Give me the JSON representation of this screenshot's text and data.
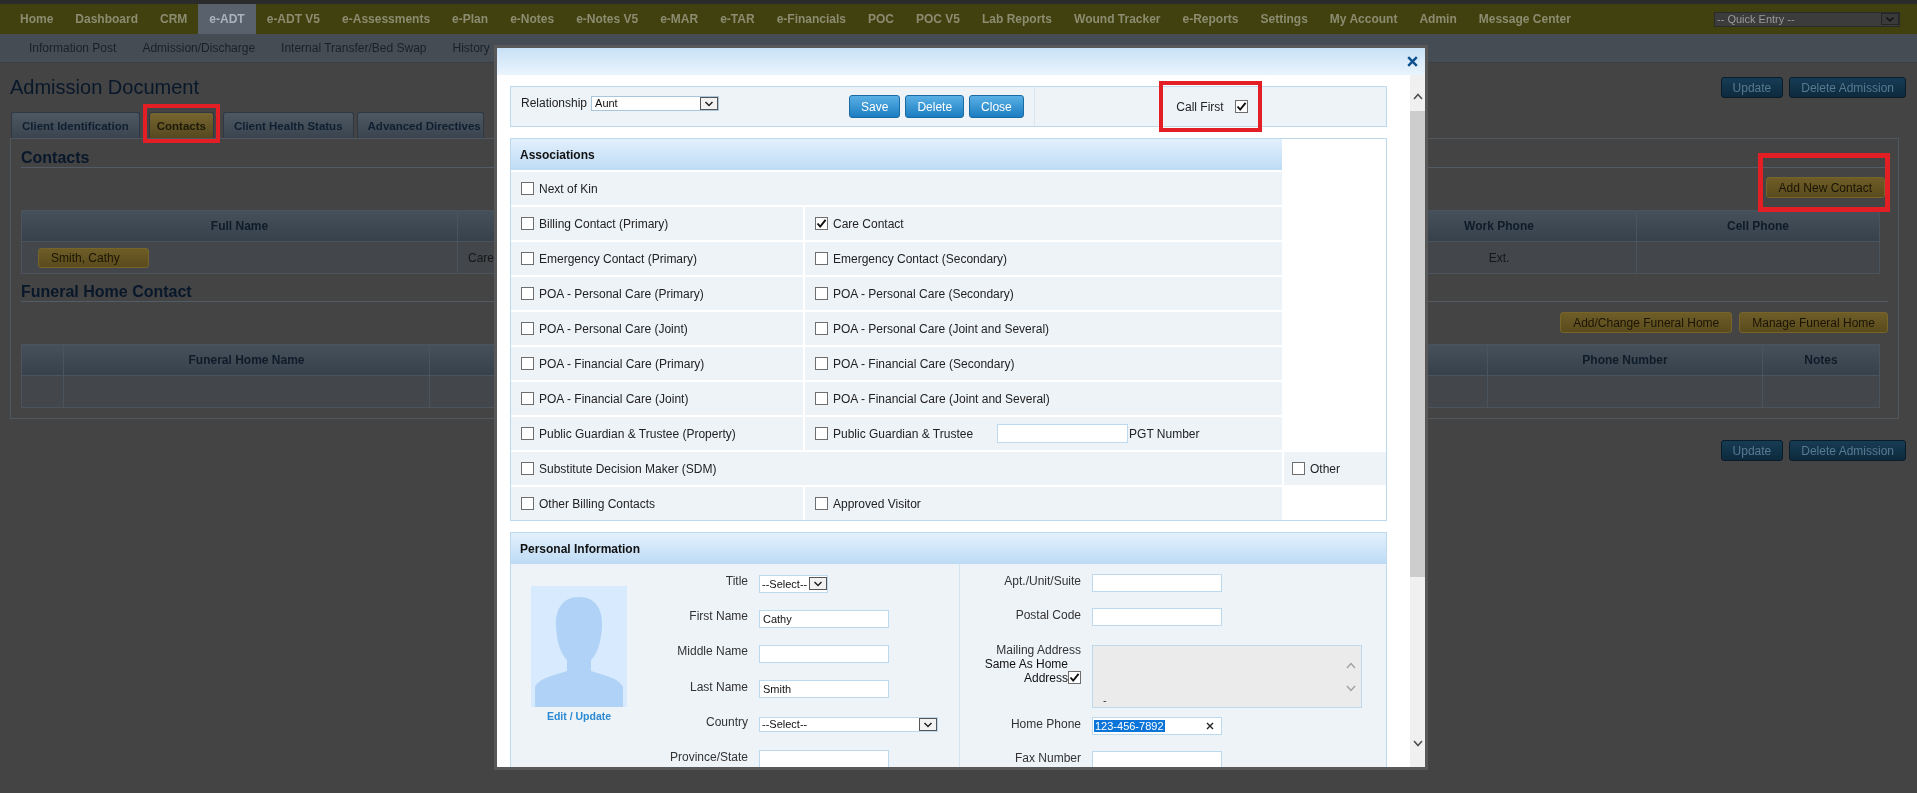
{
  "nav": {
    "items": [
      {
        "label": "Home",
        "selected": false
      },
      {
        "label": "Dashboard",
        "selected": false
      },
      {
        "label": "CRM",
        "selected": false
      },
      {
        "label": "e-ADT",
        "selected": true
      },
      {
        "label": "e-ADT V5",
        "selected": false
      },
      {
        "label": "e-Assessments",
        "selected": false
      },
      {
        "label": "e-Plan",
        "selected": false
      },
      {
        "label": "e-Notes",
        "selected": false
      },
      {
        "label": "e-Notes V5",
        "selected": false
      },
      {
        "label": "e-MAR",
        "selected": false
      },
      {
        "label": "e-TAR",
        "selected": false
      },
      {
        "label": "e-Financials",
        "selected": false
      },
      {
        "label": "POC",
        "selected": false
      },
      {
        "label": "POC V5",
        "selected": false
      },
      {
        "label": "Lab Reports",
        "selected": false
      },
      {
        "label": "Wound Tracker",
        "selected": false
      },
      {
        "label": "e-Reports",
        "selected": false
      },
      {
        "label": "Settings",
        "selected": false
      },
      {
        "label": "My Account",
        "selected": false
      },
      {
        "label": "Admin",
        "selected": false
      },
      {
        "label": "Message Center",
        "selected": false
      }
    ],
    "quick_entry": {
      "value": "-- Quick Entry --"
    }
  },
  "subnav": {
    "items": [
      "Information Post",
      "Admission/Discharge",
      "Internal Transfer/Bed Swap",
      "History"
    ]
  },
  "page": {
    "title": "Admission Document",
    "actions": [
      "Update",
      "Delete Admission"
    ],
    "tabs": [
      {
        "label": "Client Identification",
        "selected": false,
        "highlighted": false
      },
      {
        "label": "Contacts",
        "selected": true,
        "highlighted": true
      },
      {
        "label": "Client Health Status",
        "selected": false,
        "highlighted": false
      },
      {
        "label": "Advanced Directives",
        "selected": false,
        "highlighted": false
      }
    ],
    "contacts": {
      "title": "Contacts",
      "add_button": {
        "label": "Add New Contact",
        "highlighted": true
      },
      "table": {
        "headers": {
          "full_name": "Full Name",
          "work_phone": "Work Phone",
          "cell_phone": "Cell Phone"
        },
        "rows": [
          {
            "full_name": "Smith, Cathy",
            "column_2": "Care",
            "work_phone": "Ext."
          }
        ]
      }
    },
    "funeral_home": {
      "title": "Funeral Home Contact",
      "buttons": [
        "Add/Change Funeral Home",
        "Manage Funeral Home"
      ],
      "table": {
        "headers": {
          "funeral_home_name": "Funeral Home Name",
          "phone_number": "Phone Number",
          "notes": "Notes"
        }
      }
    },
    "bottom_actions": [
      "Update",
      "Delete Admission"
    ]
  },
  "dialog": {
    "relationship": {
      "label": "Relationship",
      "value": "Aunt"
    },
    "buttons": [
      "Save",
      "Delete",
      "Close"
    ],
    "call_first": {
      "label": "Call First",
      "checked": true,
      "highlighted": true
    },
    "associations": {
      "title": "Associations",
      "rows": [
        {
          "kind": "wide",
          "items": [
            {
              "label": "Next of Kin",
              "checked": false
            }
          ]
        },
        {
          "kind": "pair",
          "items": [
            {
              "label": "Billing Contact (Primary)",
              "checked": false
            },
            {
              "label": "Care Contact",
              "checked": true
            }
          ]
        },
        {
          "kind": "pair",
          "items": [
            {
              "label": "Emergency Contact (Primary)",
              "checked": false
            },
            {
              "label": "Emergency Contact (Secondary)",
              "checked": false
            }
          ]
        },
        {
          "kind": "pair",
          "items": [
            {
              "label": "POA - Personal Care (Primary)",
              "checked": false
            },
            {
              "label": "POA - Personal Care (Secondary)",
              "checked": false
            }
          ]
        },
        {
          "kind": "pair",
          "items": [
            {
              "label": "POA - Personal Care (Joint)",
              "checked": false
            },
            {
              "label": "POA - Personal Care (Joint and Several)",
              "checked": false
            }
          ]
        },
        {
          "kind": "pair",
          "items": [
            {
              "label": "POA - Financial Care (Primary)",
              "checked": false
            },
            {
              "label": "POA - Financial Care (Secondary)",
              "checked": false
            }
          ]
        },
        {
          "kind": "pair",
          "items": [
            {
              "label": "POA - Financial Care (Joint)",
              "checked": false
            },
            {
              "label": "POA - Financial Care (Joint and Several)",
              "checked": false
            }
          ]
        },
        {
          "kind": "pair",
          "items": [
            {
              "label": "Public Guardian & Trustee (Property)",
              "checked": false
            },
            {
              "label": "Public Guardian & Trustee",
              "checked": false,
              "field_label": "PGT Number"
            }
          ]
        },
        {
          "kind": "wide",
          "items": [
            {
              "label": "Substitute Decision Maker (SDM)",
              "checked": false
            }
          ],
          "side": {
            "label": "Other",
            "checked": false
          }
        },
        {
          "kind": "pair",
          "items": [
            {
              "label": "Other Billing Contacts",
              "checked": false
            },
            {
              "label": "Approved Visitor",
              "checked": false
            }
          ]
        }
      ]
    },
    "personal_information": {
      "title": "Personal Information",
      "photo_link": "Edit / Update",
      "left_fields": [
        {
          "label": "Title",
          "kind": "select",
          "value": "--Select--"
        },
        {
          "label": "First Name",
          "kind": "text",
          "value": "Cathy"
        },
        {
          "label": "Middle Name",
          "kind": "text"
        },
        {
          "label": "Last Name",
          "kind": "text",
          "value": "Smith"
        },
        {
          "label": "Country",
          "kind": "select",
          "value": "--Select--"
        },
        {
          "label": "Province/State",
          "kind": "text"
        }
      ],
      "right_fields": [
        {
          "label": "Apt./Unit/Suite",
          "kind": "text"
        },
        {
          "label": "Postal Code",
          "kind": "text"
        },
        {
          "label": "Mailing Address",
          "kind": "address",
          "checkbox_label": "Same As Home Address",
          "checked": true,
          "disabled": true,
          "value": "-"
        },
        {
          "label": "Home Phone",
          "kind": "phone",
          "value": "123-456-7892",
          "text_selected": true
        },
        {
          "label": "Fax Number",
          "kind": "text"
        }
      ]
    }
  }
}
